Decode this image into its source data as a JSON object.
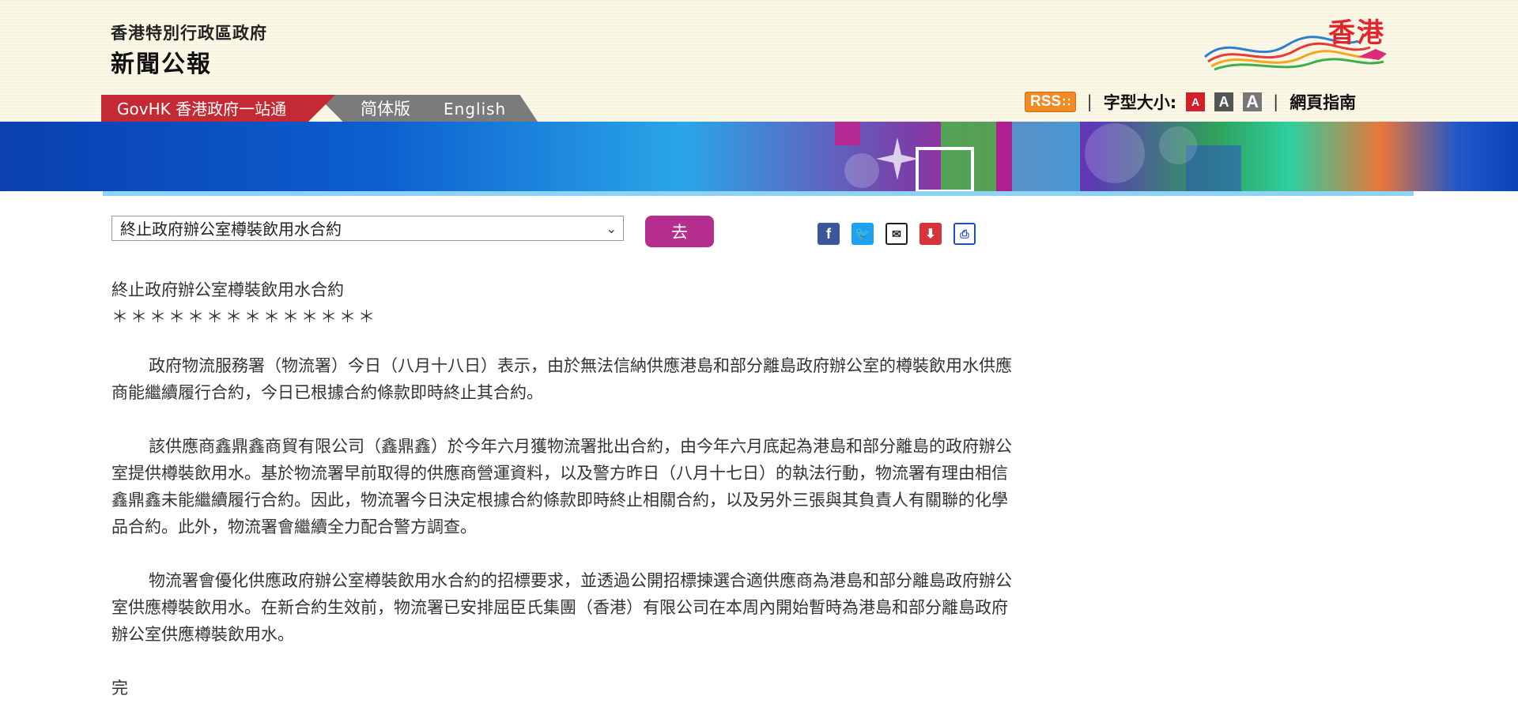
{
  "header": {
    "org_title": "香港特別行政區政府",
    "press_title": "新聞公報",
    "brand_text": "香港"
  },
  "tabs": {
    "govhk": "GovHK 香港政府一站通",
    "simplified": "简体版",
    "english": "English"
  },
  "utility": {
    "rss": "RSS",
    "separator": "|",
    "font_size_label": "字型大小:",
    "font_small": "A",
    "font_medium": "A",
    "font_large": "A",
    "site_guide": "網頁指南"
  },
  "nav": {
    "selected_topic": "終止政府辦公室樽裝飲用水合約",
    "go_label": "去"
  },
  "share": {
    "icons": [
      "facebook-icon",
      "twitter-icon",
      "email-icon",
      "download-icon",
      "print-icon"
    ]
  },
  "article": {
    "title": "終止政府辦公室樽裝飲用水合約",
    "stars": "＊＊＊＊＊＊＊＊＊＊＊＊＊＊",
    "paragraphs": [
      "政府物流服務署（物流署）今日（八月十八日）表示，由於無法信納供應港島和部分離島政府辦公室的樽裝飲用水供應商能繼續履行合約，今日已根據合約條款即時終止其合約。",
      "該供應商鑫鼎鑫商貿有限公司（鑫鼎鑫）於今年六月獲物流署批出合約，由今年六月底起為港島和部分離島的政府辦公室提供樽裝飲用水。基於物流署早前取得的供應商營運資料，以及警方昨日（八月十七日）的執法行動，物流署有理由相信鑫鼎鑫未能繼續履行合約。因此，物流署今日決定根據合約條款即時終止相關合約，以及另外三張與其負責人有關聯的化學品合約。此外，物流署會繼續全力配合警方調查。",
      "物流署會優化供應政府辦公室樽裝飲用水合約的招標要求，並透過公開招標揀選合適供應商為港島和部分離島政府辦公室供應樽裝飲用水。在新合約生效前，物流署已安排屈臣氏集團（香港）有限公司在本周內開始暫時為港島和部分離島政府辦公室供應樽裝飲用水。"
    ],
    "end": "完"
  },
  "colors": {
    "govhk_tab": "#c42a33",
    "go_button": "#b52d8f",
    "brand": "#e2242c",
    "rss": "#f08a24"
  }
}
